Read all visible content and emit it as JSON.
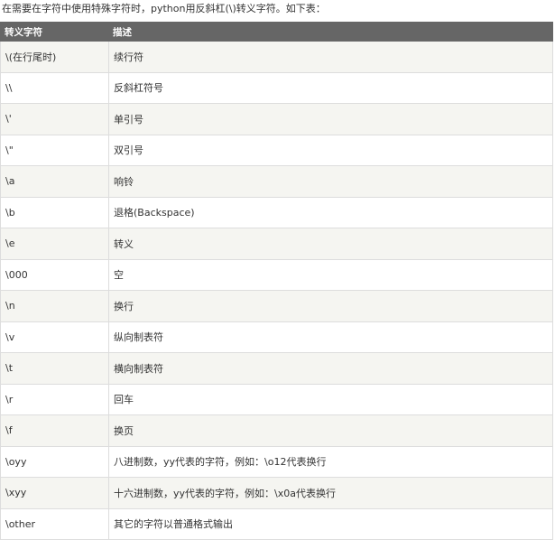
{
  "intro": "在需要在字符中使用特殊字符时，python用反斜杠(\\)转义字符。如下表：",
  "table": {
    "headers": [
      "转义字符",
      "描述"
    ],
    "rows": [
      [
        "\\(在行尾时)",
        "续行符"
      ],
      [
        "\\\\",
        "反斜杠符号"
      ],
      [
        "\\'",
        "单引号"
      ],
      [
        "\\\"",
        "双引号"
      ],
      [
        "\\a",
        "响铃"
      ],
      [
        "\\b",
        "退格(Backspace)"
      ],
      [
        "\\e",
        "转义"
      ],
      [
        "\\000",
        "空"
      ],
      [
        "\\n",
        "换行"
      ],
      [
        "\\v",
        "纵向制表符"
      ],
      [
        "\\t",
        "横向制表符"
      ],
      [
        "\\r",
        "回车"
      ],
      [
        "\\f",
        "换页"
      ],
      [
        "\\oyy",
        "八进制数，yy代表的字符，例如：\\o12代表换行"
      ],
      [
        "\\xyy",
        "十六进制数，yy代表的字符，例如：\\x0a代表换行"
      ],
      [
        "\\other",
        "其它的字符以普通格式输出"
      ]
    ]
  },
  "colors": {
    "header_bg": "#666666",
    "odd_row_bg": "#f5f5f1",
    "border": "#dddddd"
  }
}
